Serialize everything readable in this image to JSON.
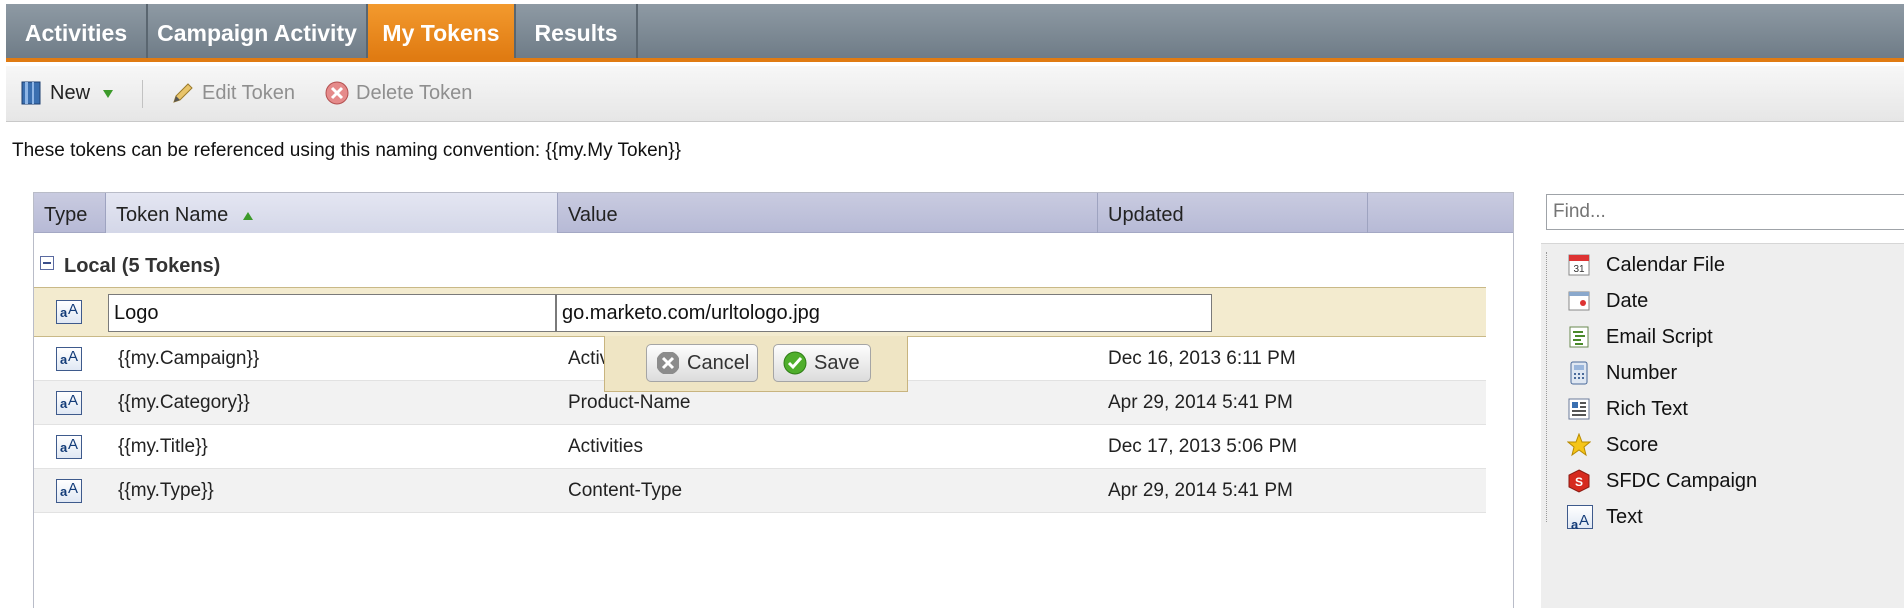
{
  "tabs": [
    {
      "label": "Activities"
    },
    {
      "label": "Campaign Activity"
    },
    {
      "label": "My Tokens"
    },
    {
      "label": "Results"
    }
  ],
  "toolbar": {
    "new_label": "New",
    "edit_label": "Edit Token",
    "delete_label": "Delete Token"
  },
  "hint": "These tokens can be referenced using this naming convention: {{my.My Token}}",
  "grid": {
    "columns": [
      "Type",
      "Token Name",
      "Value",
      "Updated"
    ],
    "group_label": "Local (5 Tokens)",
    "edit_row": {
      "name": "Logo",
      "value": "go.marketo.com/urltologo.jpg"
    },
    "rows": [
      {
        "name": "{{my.Campaign}}",
        "value": "Activi",
        "updated": "Dec 16, 2013 6:11 PM"
      },
      {
        "name": "{{my.Category}}",
        "value": "Product-Name",
        "updated": "Apr 29, 2014 5:41 PM"
      },
      {
        "name": "{{my.Title}}",
        "value": "Activities",
        "updated": "Dec 17, 2013 5:06 PM"
      },
      {
        "name": "{{my.Type}}",
        "value": "Content-Type",
        "updated": "Apr 29, 2014 5:41 PM"
      }
    ]
  },
  "popup": {
    "cancel_label": "Cancel",
    "save_label": "Save"
  },
  "find": {
    "placeholder": "Find..."
  },
  "token_types": [
    {
      "label": "Calendar File",
      "icon": "calendar-icon"
    },
    {
      "label": "Date",
      "icon": "date-icon"
    },
    {
      "label": "Email Script",
      "icon": "script-icon"
    },
    {
      "label": "Number",
      "icon": "calculator-icon"
    },
    {
      "label": "Rich Text",
      "icon": "rich-text-icon"
    },
    {
      "label": "Score",
      "icon": "star-icon"
    },
    {
      "label": "SFDC Campaign",
      "icon": "sfdc-icon"
    },
    {
      "label": "Text",
      "icon": "text-icon"
    }
  ],
  "colors": {
    "accent": "#e07b12",
    "tabbar": "#7d8a95",
    "header": "#bfc2dc",
    "edit_row": "#f3ebcf"
  }
}
